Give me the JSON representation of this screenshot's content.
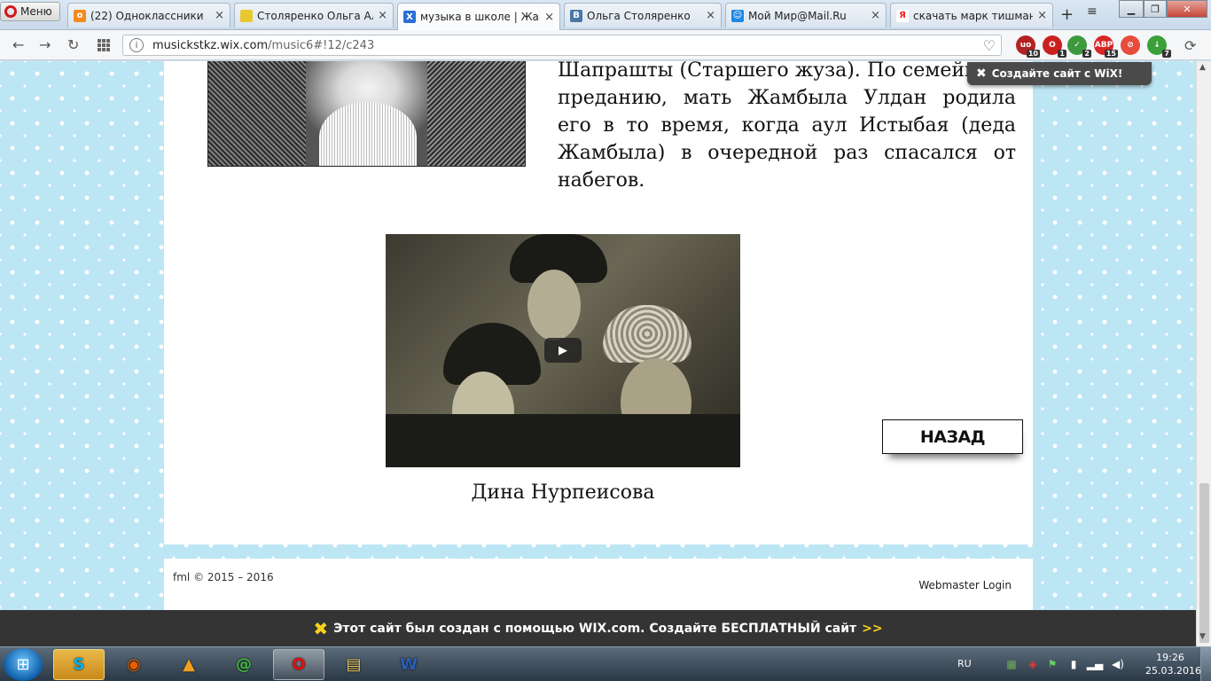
{
  "browser": {
    "menu_label": "Меню",
    "tabs": [
      {
        "title": "(22) Одноклассники",
        "icon": "odnoklassniki-icon",
        "color": "#f28a1f",
        "glyph": "o",
        "active": false
      },
      {
        "title": "Столяренко Ольга Алекс",
        "icon": "page-icon",
        "color": "#e8c830",
        "glyph": "",
        "active": false
      },
      {
        "title": "музыка в школе | Жамбы",
        "icon": "wix-icon",
        "color": "#2a6fd6",
        "glyph": "X",
        "active": true
      },
      {
        "title": "Ольга Столяренко",
        "icon": "vk-icon",
        "color": "#4a76a8",
        "glyph": "B",
        "active": false
      },
      {
        "title": "Мой Мир@Mail.Ru",
        "icon": "mymail-icon",
        "color": "#1e88e5",
        "glyph": "☺",
        "active": false
      },
      {
        "title": "скачать марк тишман вс",
        "icon": "yandex-icon",
        "color": "#ffffff",
        "glyph": "Я",
        "active": false
      }
    ],
    "url_host": "musickstkz.wix.com",
    "url_path": "/music6#!12/c243",
    "extensions": [
      {
        "icon": "ublock-icon",
        "color": "#b22222",
        "badge": "10",
        "glyph": "uo"
      },
      {
        "icon": "opera-turbo-icon",
        "color": "#cc1f1f",
        "badge": "1",
        "glyph": "O"
      },
      {
        "icon": "shield-icon",
        "color": "#3c9a3c",
        "badge": "2",
        "glyph": "✓"
      },
      {
        "icon": "adblock-icon",
        "color": "#d92626",
        "badge": "15",
        "glyph": "ABP"
      },
      {
        "icon": "stop-icon",
        "color": "#e74c3c",
        "badge": "",
        "glyph": "⊘"
      },
      {
        "icon": "download-icon",
        "color": "#3aa03a",
        "badge": "7",
        "glyph": "↓"
      }
    ]
  },
  "page": {
    "bio_text": "Шапрашты (Старшего жуза). По семейному преданию, мать Жамбыла Улдан родила его в то время, когда аул Истыбая (деда Жамбыла) в очередной раз спасался от набегов.",
    "caption": "Дина Нурпеисова",
    "back_label": "НАЗАД",
    "copyright": "fml © 2015 – 2016",
    "webmaster_login": "Webmaster Login",
    "wix_popup": "Создайте сайт с WiX!",
    "wix_banner": "Этот сайт был создан с помощью WIX.com. Создайте БЕСПЛАТНЫЙ сайт",
    "wix_banner_arrow": ">>"
  },
  "taskbar": {
    "apps": [
      {
        "icon": "skype-icon",
        "glyph": "S",
        "color": "#00aff0",
        "state": "hot"
      },
      {
        "icon": "firefox-icon",
        "glyph": "◉",
        "color": "#e66000",
        "state": "pinned"
      },
      {
        "icon": "aimp-icon",
        "glyph": "▲",
        "color": "#f0a020",
        "state": "pinned"
      },
      {
        "icon": "mail-agent-icon",
        "glyph": "@",
        "color": "#3dbb3d",
        "state": "pinned"
      },
      {
        "icon": "opera-icon",
        "glyph": "O",
        "color": "#e01010",
        "state": "open"
      },
      {
        "icon": "explorer-folder-icon",
        "glyph": "▤",
        "color": "#e9c45a",
        "state": "pinned"
      },
      {
        "icon": "word-icon",
        "glyph": "W",
        "color": "#2b5fb4",
        "state": "pinned"
      }
    ],
    "language": "RU",
    "time": "19:26",
    "date": "25.03.2016"
  }
}
